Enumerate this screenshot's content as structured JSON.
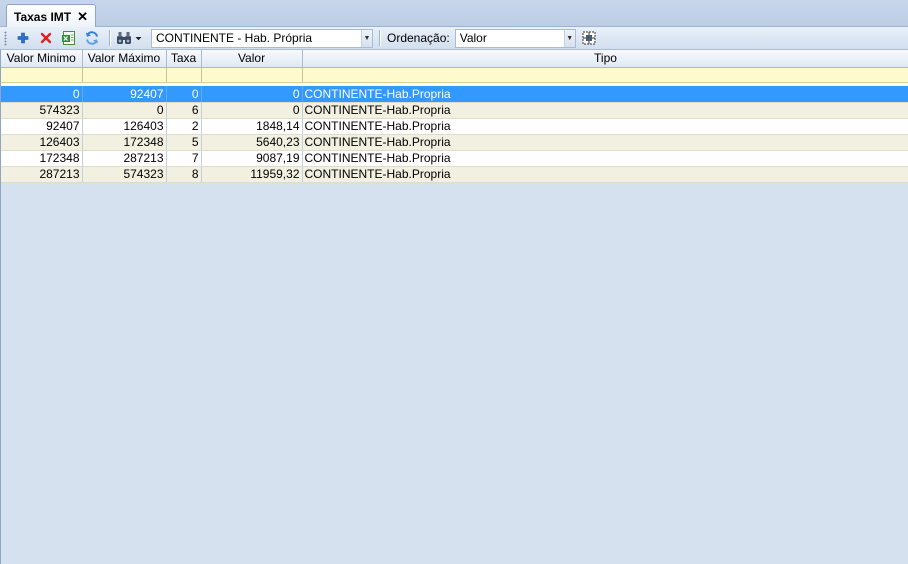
{
  "tab": {
    "title": "Taxas IMT",
    "close_label": "✕"
  },
  "toolbar": {
    "filter_value": "CONTINENTE - Hab. Própria",
    "sort_label": "Ordenação:",
    "sort_value": "Valor"
  },
  "colors": {
    "selection": "#3399ff",
    "filter_row": "#fffacd",
    "alt_row": "#f2f0e1"
  },
  "table": {
    "columns": [
      "Valor Minimo",
      "Valor Máximo",
      "Taxa",
      "Valor",
      "Tipo"
    ],
    "rows": [
      [
        "0",
        "92407",
        "0",
        "0",
        "CONTINENTE-Hab.Propria"
      ],
      [
        "574323",
        "0",
        "6",
        "0",
        "CONTINENTE-Hab.Propria"
      ],
      [
        "92407",
        "126403",
        "2",
        "1848,14",
        "CONTINENTE-Hab.Propria"
      ],
      [
        "126403",
        "172348",
        "5",
        "5640,23",
        "CONTINENTE-Hab.Propria"
      ],
      [
        "172348",
        "287213",
        "7",
        "9087,19",
        "CONTINENTE-Hab.Propria"
      ],
      [
        "287213",
        "574323",
        "8",
        "11959,32",
        "CONTINENTE-Hab.Propria"
      ]
    ]
  }
}
